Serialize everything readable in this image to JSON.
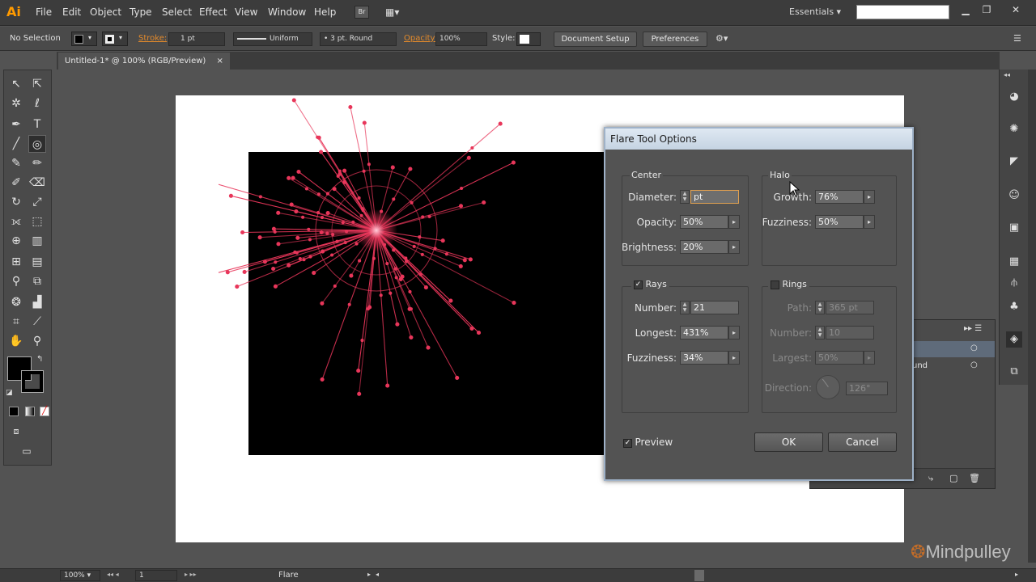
{
  "app": {
    "logo": "Ai",
    "accent": "#ff9a00"
  },
  "menu": [
    "File",
    "Edit",
    "Object",
    "Type",
    "Select",
    "Effect",
    "View",
    "Window",
    "Help"
  ],
  "workspace": {
    "label": "Essentials",
    "search_placeholder": ""
  },
  "control_bar": {
    "selection": "No Selection",
    "stroke_label": "Stroke:",
    "stroke_weight": "1 pt",
    "profile": "Uniform",
    "brush": "3 pt. Round",
    "opacity_label": "Opacity:",
    "opacity": "100%",
    "style_label": "Style:",
    "document_setup": "Document Setup",
    "preferences": "Preferences"
  },
  "document_tab": {
    "title": "Untitled-1* @ 100% (RGB/Preview)",
    "close": "×"
  },
  "status_bar": {
    "zoom": "100%",
    "artboard": "1",
    "tool": "Flare"
  },
  "layers_panel": {
    "row2_label": "und"
  },
  "watermark": "Mindpulley",
  "dialog": {
    "title": "Flare Tool Options",
    "center": {
      "title": "Center",
      "diameter_label": "Diameter:",
      "diameter": "pt",
      "opacity_label": "Opacity:",
      "opacity": "50%",
      "brightness_label": "Brightness:",
      "brightness": "20%"
    },
    "halo": {
      "title": "Halo",
      "growth_label": "Growth:",
      "growth": "76%",
      "fuzziness_label": "Fuzziness:",
      "fuzziness": "50%"
    },
    "rays": {
      "title": "Rays",
      "checked": true,
      "number_label": "Number:",
      "number": "21",
      "longest_label": "Longest:",
      "longest": "431%",
      "fuzziness_label": "Fuzziness:",
      "fuzziness": "34%"
    },
    "rings": {
      "title": "Rings",
      "checked": false,
      "path_label": "Path:",
      "path": "365 pt",
      "number_label": "Number:",
      "number": "10",
      "largest_label": "Largest:",
      "largest": "50%",
      "direction_label": "Direction:",
      "direction": "126°"
    },
    "preview_label": "Preview",
    "preview_checked": true,
    "ok": "OK",
    "cancel": "Cancel"
  },
  "flare_color": "#e8365a"
}
